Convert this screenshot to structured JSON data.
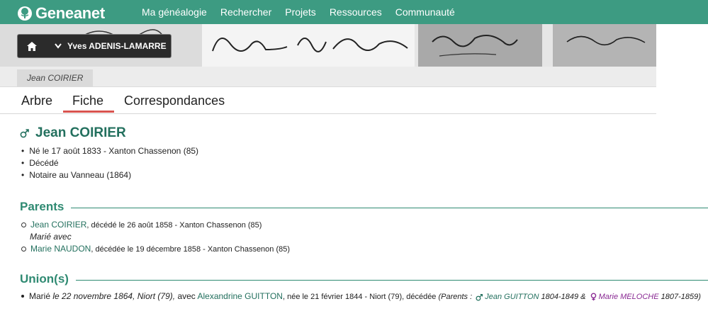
{
  "brand": {
    "name": "Geneanet"
  },
  "nav": [
    "Ma généalogie",
    "Rechercher",
    "Projets",
    "Ressources",
    "Communauté"
  ],
  "user": {
    "name": "Yves ADENIS-LAMARRE"
  },
  "breadcrumb": "Jean COIRIER",
  "tabs": [
    "Arbre",
    "Fiche",
    "Correspondances"
  ],
  "active_tab": "Fiche",
  "person": {
    "name": "Jean COIRIER",
    "facts": [
      "Né le 17 août 1833 - Xanton Chassenon (85)",
      "Décédé",
      "Notaire au Vanneau (1864)"
    ]
  },
  "parents": {
    "title": "Parents",
    "father_name": "Jean COIRIER",
    "father_detail": ", décédé le 26 août 1858 - Xanton Chassenon (85)",
    "married_with": "Marié avec",
    "mother_name": "Marie NAUDON",
    "mother_detail": ", décédée le 19 décembre 1858 - Xanton Chassenon (85)"
  },
  "unions": {
    "title": "Union(s)",
    "prefix": "Marié ",
    "date_place": "le 22 novembre 1864, Niort (79),",
    "avec": " avec ",
    "spouse": "Alexandrine GUITTON",
    "spouse_detail": ", née le 21 février 1844 - Niort (79), décédée ",
    "parents_label": "(Parents : ",
    "spouse_father": "Jean GUITTON",
    "spouse_father_years": " 1804-1849 & ",
    "spouse_mother": "Marie MELOCHE",
    "spouse_mother_years": " 1807-1859)"
  },
  "colors": {
    "brand_green": "#3d9b82",
    "link_green": "#23705e",
    "active_tab": "#d9534f"
  }
}
